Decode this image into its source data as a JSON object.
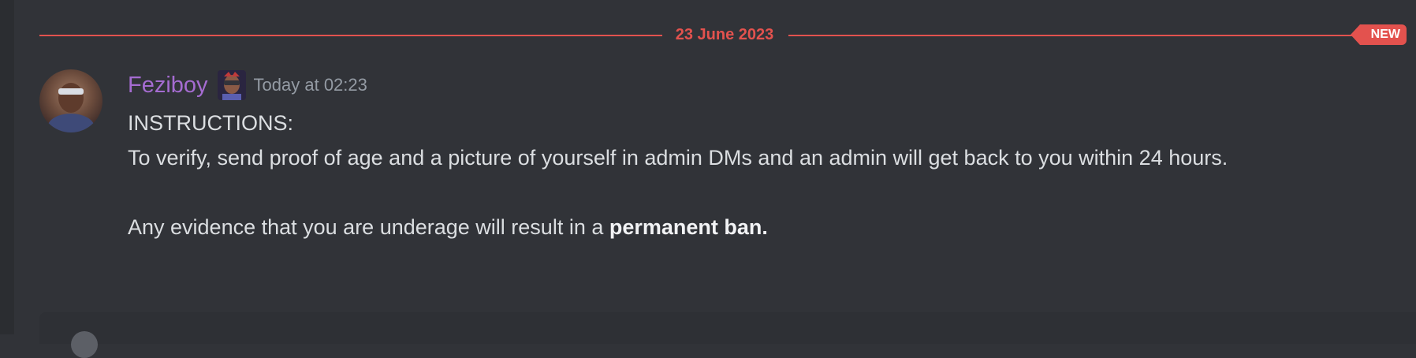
{
  "divider": {
    "date": "23 June 2023",
    "new_label": "NEW"
  },
  "message": {
    "author": "Feziboy",
    "timestamp": "Today at 02:23",
    "line1": "INSTRUCTIONS:",
    "line2": "To verify, send proof of age and a picture of yourself in admin DMs and an admin will get back to you within 24 hours.",
    "line3_prefix": "Any evidence that you are underage will result in a ",
    "line3_bold": "permanent ban."
  },
  "colors": {
    "background": "#313338",
    "accent_red": "#e3524e",
    "username": "#a56cd1",
    "text": "#dbdee1",
    "muted": "#949ba4"
  }
}
